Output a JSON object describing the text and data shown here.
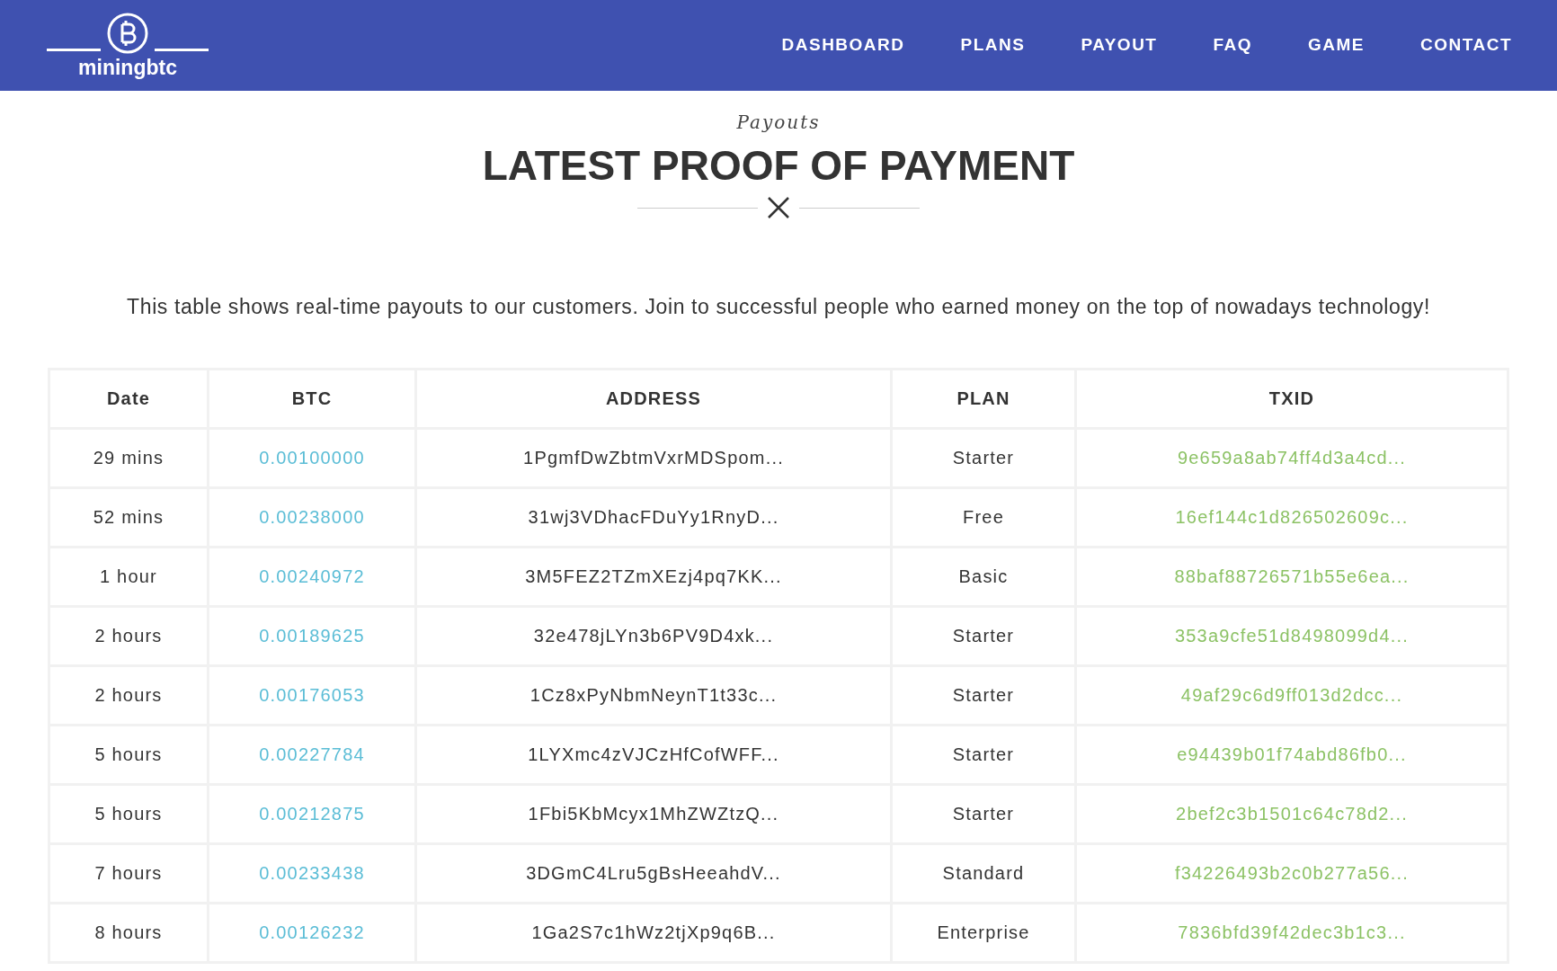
{
  "brand": {
    "name": "miningbtc"
  },
  "nav": [
    {
      "label": "DASHBOARD"
    },
    {
      "label": "PLANS"
    },
    {
      "label": "PAYOUT"
    },
    {
      "label": "FAQ"
    },
    {
      "label": "GAME"
    },
    {
      "label": "CONTACT"
    }
  ],
  "section": {
    "kicker": "Payouts",
    "title": "LATEST PROOF OF PAYMENT",
    "intro": "This table shows real-time payouts to our customers. Join to successful people who earned money on the top of nowadays technology!"
  },
  "table": {
    "columns": [
      "Date",
      "BTC",
      "ADDRESS",
      "PLAN",
      "TXID"
    ],
    "rows": [
      {
        "date": "29 mins",
        "btc": "0.00100000",
        "address": "1PgmfDwZbtmVxrMDSpom...",
        "plan": "Starter",
        "txid": "9e659a8ab74ff4d3a4cd..."
      },
      {
        "date": "52 mins",
        "btc": "0.00238000",
        "address": "31wj3VDhacFDuYy1RnyD...",
        "plan": "Free",
        "txid": "16ef144c1d826502609c..."
      },
      {
        "date": "1 hour",
        "btc": "0.00240972",
        "address": "3M5FEZ2TZmXEzj4pq7KK...",
        "plan": "Basic",
        "txid": "88baf88726571b55e6ea..."
      },
      {
        "date": "2 hours",
        "btc": "0.00189625",
        "address": "32e478jLYn3b6PV9D4xk...",
        "plan": "Starter",
        "txid": "353a9cfe51d8498099d4..."
      },
      {
        "date": "2 hours",
        "btc": "0.00176053",
        "address": "1Cz8xPyNbmNeynT1t33c...",
        "plan": "Starter",
        "txid": "49af29c6d9ff013d2dcc..."
      },
      {
        "date": "5 hours",
        "btc": "0.00227784",
        "address": "1LYXmc4zVJCzHfCofWFF...",
        "plan": "Starter",
        "txid": "e94439b01f74abd86fb0..."
      },
      {
        "date": "5 hours",
        "btc": "0.00212875",
        "address": "1Fbi5KbMcyx1MhZWZtzQ...",
        "plan": "Starter",
        "txid": "2bef2c3b1501c64c78d2..."
      },
      {
        "date": "7 hours",
        "btc": "0.00233438",
        "address": "3DGmC4Lru5gBsHeeahdV...",
        "plan": "Standard",
        "txid": "f34226493b2c0b277a56..."
      },
      {
        "date": "8 hours",
        "btc": "0.00126232",
        "address": "1Ga2S7c1hWz2tjXp9q6B...",
        "plan": "Enterprise",
        "txid": "7836bfd39f42dec3b1c3..."
      }
    ]
  }
}
